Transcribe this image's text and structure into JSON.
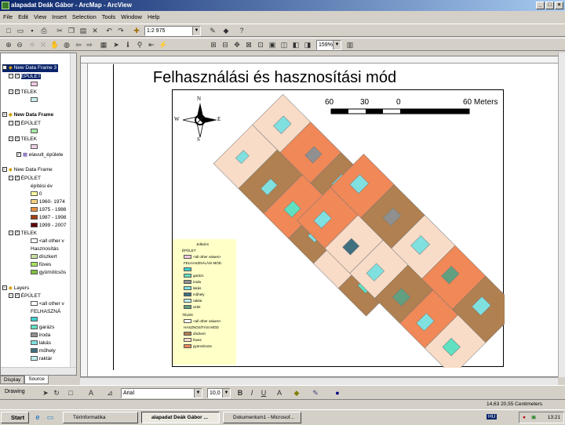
{
  "window": {
    "title": "alapadat Deák Gábor - ArcMap - ArcView",
    "buttons": [
      "_",
      "□",
      "×"
    ]
  },
  "menu": [
    "File",
    "Edit",
    "View",
    "Insert",
    "Selection",
    "Tools",
    "Window",
    "Help"
  ],
  "toolbar": {
    "scale": "1:2 975",
    "zoom": "159%"
  },
  "toc": {
    "frames": [
      {
        "name": "New Data Frame 3",
        "layers": [
          {
            "name": "ÉPÜLET",
            "swatch": "#f0c8e0"
          },
          {
            "name": "TELEK",
            "swatch": "#c8f0f0"
          }
        ]
      },
      {
        "name": "New Data Frame",
        "layers": [
          {
            "name": "ÉPÜLET",
            "swatch": "#a8e8a8"
          },
          {
            "name": "TELEK",
            "swatch": "#f0d0e8"
          },
          {
            "name": "elavult_épülete"
          }
        ]
      },
      {
        "name": "New Data Frame",
        "layers": [
          {
            "name": "ÉPÜLET",
            "heading": "építési év",
            "classes": [
              {
                "label": "0",
                "color": "#ffffa0"
              },
              {
                "label": "1960- 1974",
                "color": "#f8d080"
              },
              {
                "label": "1975 - 1986",
                "color": "#e89040"
              },
              {
                "label": "1987 - 1998",
                "color": "#a04010"
              },
              {
                "label": "1999 - 2007",
                "color": "#600000"
              }
            ]
          },
          {
            "name": "TELEK",
            "heading": "<all other v",
            "subheading": "Hasznosítás",
            "classes": [
              {
                "label": "díszkert",
                "color": "#c8e0a0"
              },
              {
                "label": "füves",
                "color": "#a8e060"
              },
              {
                "label": "gyümölcsös",
                "color": "#80c040"
              }
            ]
          }
        ]
      },
      {
        "name": "Layers",
        "layers": [
          {
            "name": "ÉPÜLET",
            "heading": "<all other v",
            "subheading": "FELHASZNÁ",
            "classes": [
              {
                "label": "",
                "color": "#40d0d0"
              },
              {
                "label": "garázs",
                "color": "#60e0c0"
              },
              {
                "label": "iroda",
                "color": "#909090"
              },
              {
                "label": "lakás",
                "color": "#80e0e0"
              },
              {
                "label": "műhely",
                "color": "#407080"
              },
              {
                "label": "raktár",
                "color": "#c0f0f0"
              }
            ]
          }
        ]
      }
    ],
    "tabs": [
      "Display",
      "Source"
    ]
  },
  "map": {
    "title": "Felhasználási és hasznosítási mód",
    "scalebar": {
      "labels": [
        "60",
        "30",
        "0",
        "60 Meters"
      ]
    },
    "north": [
      "N",
      "S",
      "W",
      "E"
    ],
    "legend": {
      "title": "Jelkulcs",
      "epulet": "ÉPÜLET",
      "all_other": "<all other values>",
      "felh_mod": "FELHASZNÁLÁSI MÓD",
      "building_classes": [
        {
          "label": "",
          "color": "#40d0d0"
        },
        {
          "label": "garázs",
          "color": "#60e0c0"
        },
        {
          "label": "iroda",
          "color": "#909090"
        },
        {
          "label": "lakás",
          "color": "#80e0e0"
        },
        {
          "label": "műhely",
          "color": "#407080"
        },
        {
          "label": "raktár",
          "color": "#c0f0f0"
        },
        {
          "label": "üzlet",
          "color": "#60a080"
        }
      ],
      "telek": "TELEK",
      "hasz_mod": "HASZNOSÍTÁSI MÓD",
      "parcel_classes": [
        {
          "label": "díszkert",
          "color": "#b08050"
        },
        {
          "label": "füves",
          "color": "#f8dcc8"
        },
        {
          "label": "gyümölcsös",
          "color": "#f08858"
        }
      ]
    }
  },
  "drawbar": {
    "drawing": "Drawing",
    "font": "Arial",
    "size": "10,0",
    "bold": "B",
    "italic": "I",
    "underline": "U"
  },
  "status": {
    "coords": "14,63  20,55 Centimeters"
  },
  "taskbar": {
    "start": "Start",
    "items": [
      "Térinformatika",
      "alapadat Deák Gábor ...",
      "Dokumentum1 - Microsof..."
    ],
    "lang": "HU",
    "time": "13:21"
  },
  "colors": {
    "diszkert": "#b08050",
    "fuves": "#f8dcc8",
    "gyumolcsos": "#f08858"
  }
}
